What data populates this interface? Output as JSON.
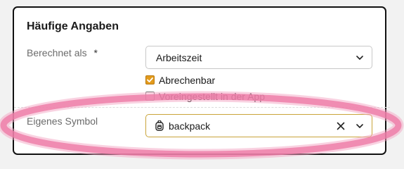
{
  "section": {
    "title": "Häufige Angaben"
  },
  "berechnet": {
    "label": "Berechnet als",
    "required_marker": "*",
    "value": "Arbeitszeit"
  },
  "checkboxes": [
    {
      "label": "Abrechenbar",
      "checked": true
    },
    {
      "label": "Voreingestellt in der App",
      "checked": false
    }
  ],
  "symbol": {
    "label": "Eigenes Symbol",
    "value": "backpack",
    "icon": "backpack-icon"
  },
  "colors": {
    "accent": "#e39b1d",
    "highlight": "#e8508a",
    "focus_border": "#c9a43a"
  }
}
